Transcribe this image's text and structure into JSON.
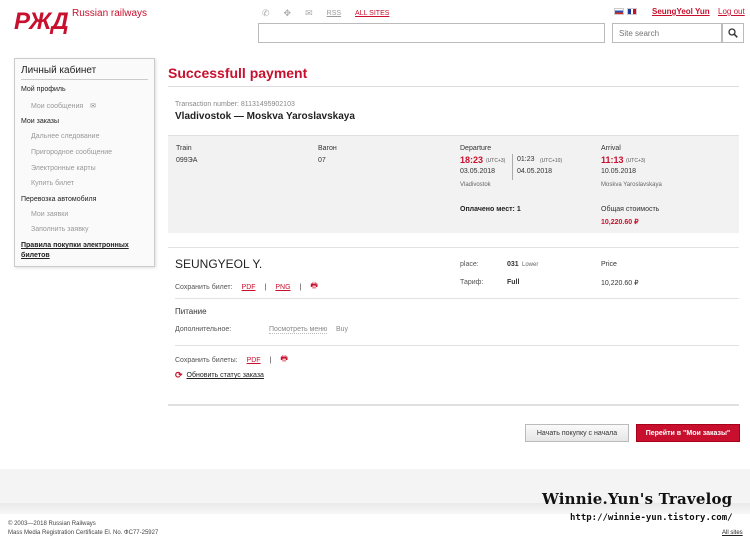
{
  "header": {
    "brand": "Russian railways",
    "icons": [
      "phone-icon",
      "settings-icon",
      "mail-icon"
    ],
    "rss": "RSS",
    "all_sites": "ALL SITES",
    "user": "SeungYeol Yun",
    "logout": "Log out",
    "search_placeholder": "Site search"
  },
  "sidebar": {
    "title": "Личный кабинет",
    "profile": "Мой профиль",
    "messages": "Мои сообщения",
    "orders": "Мои заказы",
    "long_distance": "Дальнее следование",
    "suburban": "Пригородное сообщение",
    "cards": "Электронные карты",
    "buy": "Купить билет",
    "car_transport": "Перевозка автомобиля",
    "my_requests": "Мои заявки",
    "fill_request": "Заполнить заявку",
    "rules_line1": "Правила покупки электронных",
    "rules_line2": "билетов"
  },
  "main": {
    "title": "Successfull payment",
    "transaction": "Transaction number: 81131495902103",
    "route": "Vladivostok — Moskva Yaroslavskaya",
    "train_label": "Train",
    "train_value": "099ЭА",
    "car_label": "Вагон",
    "car_value": "07",
    "departure_label": "Departure",
    "dep_time": "18:23",
    "dep_tz": "(UTC+3)",
    "dep_date": "03.05.2018",
    "dep_city": "Vladivostok",
    "local_time": "01:23",
    "local_tz": "(UTC+10)",
    "local_date": "04.05.2018",
    "arrival_label": "Arrival",
    "arr_time": "11:13",
    "arr_tz": "(UTC+3)",
    "arr_date": "10.05.2018",
    "arr_city": "Moskva Yaroslavskaya",
    "seats_paid": "Оплачено мест: 1",
    "total_label": "Общая стоимость",
    "total_value": "10,220.60 ₽",
    "passenger": "SEUNGYEOL Y.",
    "save_ticket": "Сохранить билет:",
    "pdf": "PDF",
    "png": "PNG",
    "sep": "|",
    "place_label": "place:",
    "place_value": "031",
    "place_type": "Lower",
    "tariff_label": "Тариф:",
    "tariff_value": "Full",
    "price_label": "Price",
    "price_value": "10,220.60 ₽",
    "meals_title": "Питание",
    "additional_label": "Дополнительное:",
    "view_menu": "Посмотреть меню",
    "buy": "Buy",
    "save_tickets": "Сохранить билеты:",
    "refresh_status": "Обновить статус заказа",
    "btn_restart": "Начать покупку с начала",
    "btn_my_orders": "Перейти в \"Мои заказы\""
  },
  "footer": {
    "copyright": "© 2003—2018  Russian Railways",
    "certificate": "Mass Media Registration Certificate El. No. ФС77-25927",
    "all_sites": "All sites",
    "watermark_title": "Winnie.Yun's Travelog",
    "watermark_url": "http://winnie-yun.tistory.com/"
  },
  "colors": {
    "accent": "#c8102e",
    "panel": "#f2f2f2"
  }
}
